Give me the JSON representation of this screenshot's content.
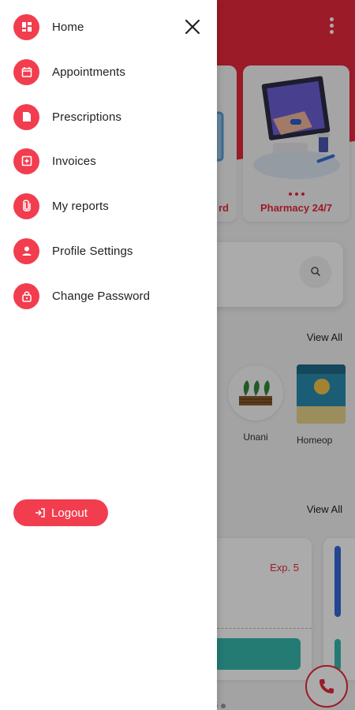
{
  "drawer": {
    "menu": [
      {
        "label": "Home",
        "icon": "dashboard-icon"
      },
      {
        "label": "Appointments",
        "icon": "calendar-icon"
      },
      {
        "label": "Prescriptions",
        "icon": "document-icon"
      },
      {
        "label": "Invoices",
        "icon": "invoice-icon"
      },
      {
        "label": "My reports",
        "icon": "paperclip-icon"
      },
      {
        "label": "Profile Settings",
        "icon": "person-icon"
      },
      {
        "label": "Change Password",
        "icon": "lock-icon"
      }
    ],
    "logout_label": "Logout"
  },
  "background": {
    "promo_cards": [
      "rd",
      "Pharmacy 24/7"
    ],
    "view_all_label": "View All",
    "categories": [
      "Unani",
      "Homeop"
    ],
    "appointment_expiry": "Exp. 5"
  },
  "colors": {
    "accent": "#f23d4f",
    "header": "#e8293d",
    "teal": "#37b8ad",
    "blue": "#3569d6"
  }
}
